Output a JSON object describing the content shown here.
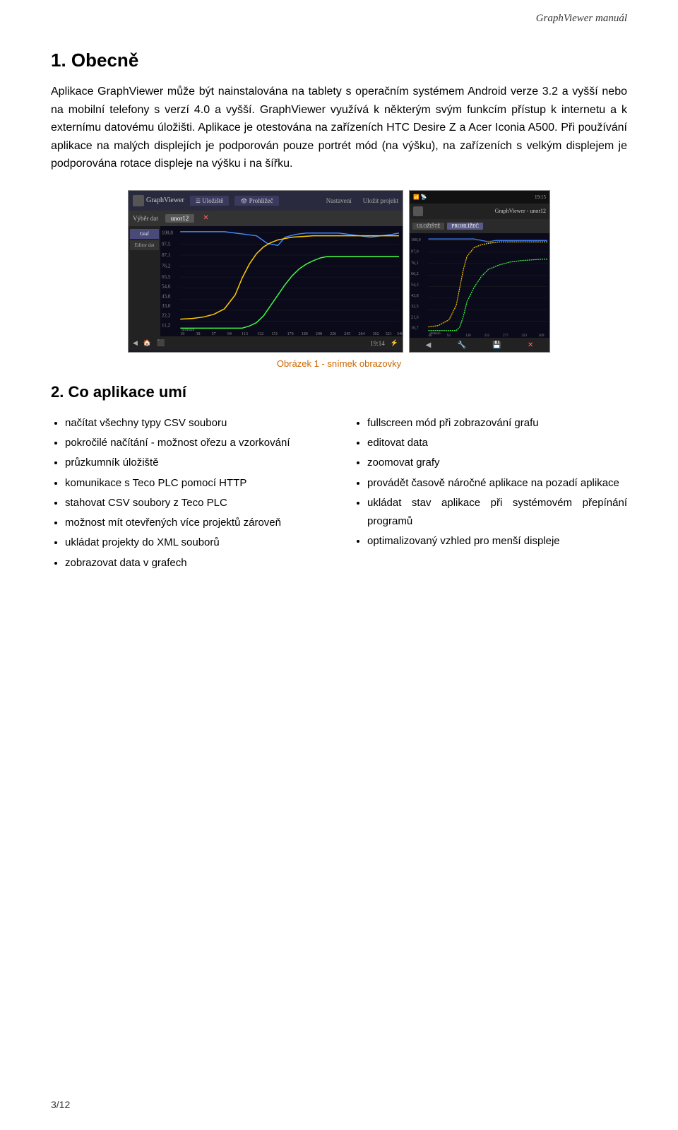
{
  "header": {
    "title": "GraphViewer manuál"
  },
  "section1": {
    "heading": "1. Obecně",
    "paragraphs": [
      "Aplikace GraphViewer může být nainstalována na tablety s operačním systémem Android verze 3.2 a vyšší nebo na mobilní telefony s verzí 4.0 a vyšší. GraphViewer využívá k některým svým funkcím přístup k internetu a k externímu datovému úložišti. Aplikace je otestována na zařízeních HTC Desire Z a Acer Iconia A500. Při používání aplikace na malých displejích je podporován pouze portrét mód (na výšku), na zařízeních s velkým displejem je podporována rotace displeje na výšku i na šířku."
    ]
  },
  "figure_caption": "Obrázek 1 - snímek obrazovky",
  "section2": {
    "heading": "2. Co aplikace umí",
    "col1_items": [
      "načítat všechny typy CSV souboru",
      "pokročilé načítání - možnost ořezu a vzorkování",
      "průzkumník úložiště",
      "komunikace s Teco PLC pomocí HTTP",
      "stahovat CSV soubory z Teco PLC",
      "možnost mít otevřených více projektů zároveň",
      "ukládat projekty do XML souborů",
      "zobrazovat data v grafech"
    ],
    "col2_items": [
      "fullscreen mód při zobrazování grafu",
      "editovat data",
      "zoomovat grafy",
      "provádět časově náročné aplikace na pozadí aplikace",
      "ukládat stav aplikace při systémovém přepínání programů",
      "optimalizovaný vzhled pro menší displeje"
    ]
  },
  "footer": {
    "page": "3/12"
  },
  "screen_left": {
    "app_name": "GraphViewer",
    "tab1": "Uložiště",
    "tab2": "Prohlížeč",
    "tab_active": "unor12",
    "menu1": "Nastavení",
    "menu2": "Uložit projekt",
    "sidebar_items": [
      "Graf",
      "Editor dat"
    ],
    "time": "19:14"
  },
  "screen_right": {
    "title": "GraphViewer - unor12",
    "time": "19:15",
    "tab1": "ULOŽIŠTĚ",
    "tab2": "PROHLÍŽEČ"
  }
}
